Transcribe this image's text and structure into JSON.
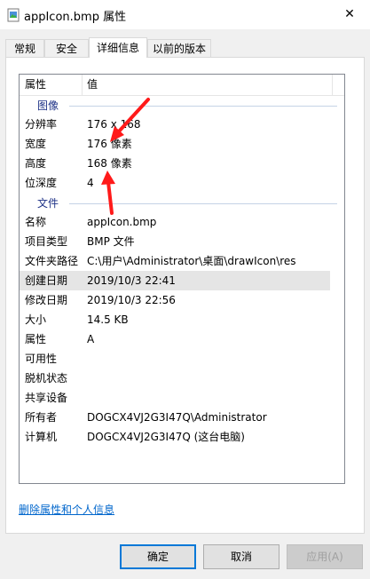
{
  "window": {
    "title": "appIcon.bmp 属性",
    "close_glyph": "✕"
  },
  "tabs": [
    {
      "label": "常规"
    },
    {
      "label": "安全"
    },
    {
      "label": "详细信息"
    },
    {
      "label": "以前的版本"
    }
  ],
  "list": {
    "header": {
      "property": "属性",
      "value": "值"
    },
    "image_group": "图像",
    "image_rows": [
      {
        "k": "分辨率",
        "v": "176 x 168"
      },
      {
        "k": "宽度",
        "v": "176 像素"
      },
      {
        "k": "高度",
        "v": "168 像素"
      },
      {
        "k": "位深度",
        "v": "4"
      }
    ],
    "file_group": "文件",
    "file_rows": [
      {
        "k": "名称",
        "v": "appIcon.bmp"
      },
      {
        "k": "项目类型",
        "v": "BMP 文件"
      },
      {
        "k": "文件夹路径",
        "v": "C:\\用户\\Administrator\\桌面\\drawIcon\\res"
      },
      {
        "k": "创建日期",
        "v": "2019/10/3 22:41"
      },
      {
        "k": "修改日期",
        "v": "2019/10/3 22:56"
      },
      {
        "k": "大小",
        "v": "14.5 KB"
      },
      {
        "k": "属性",
        "v": "A"
      },
      {
        "k": "可用性",
        "v": ""
      },
      {
        "k": "脱机状态",
        "v": ""
      },
      {
        "k": "共享设备",
        "v": ""
      },
      {
        "k": "所有者",
        "v": "DOGCX4VJ2G3I47Q\\Administrator"
      },
      {
        "k": "计算机",
        "v": "DOGCX4VJ2G3I47Q (这台电脑)"
      }
    ]
  },
  "remove_link": "删除属性和个人信息",
  "buttons": {
    "ok": "确定",
    "cancel": "取消",
    "apply": "应用(A)"
  },
  "colors": {
    "annotation_arrow": "#ff1a1a",
    "link": "#0066cc",
    "group_text": "#1e3287"
  }
}
